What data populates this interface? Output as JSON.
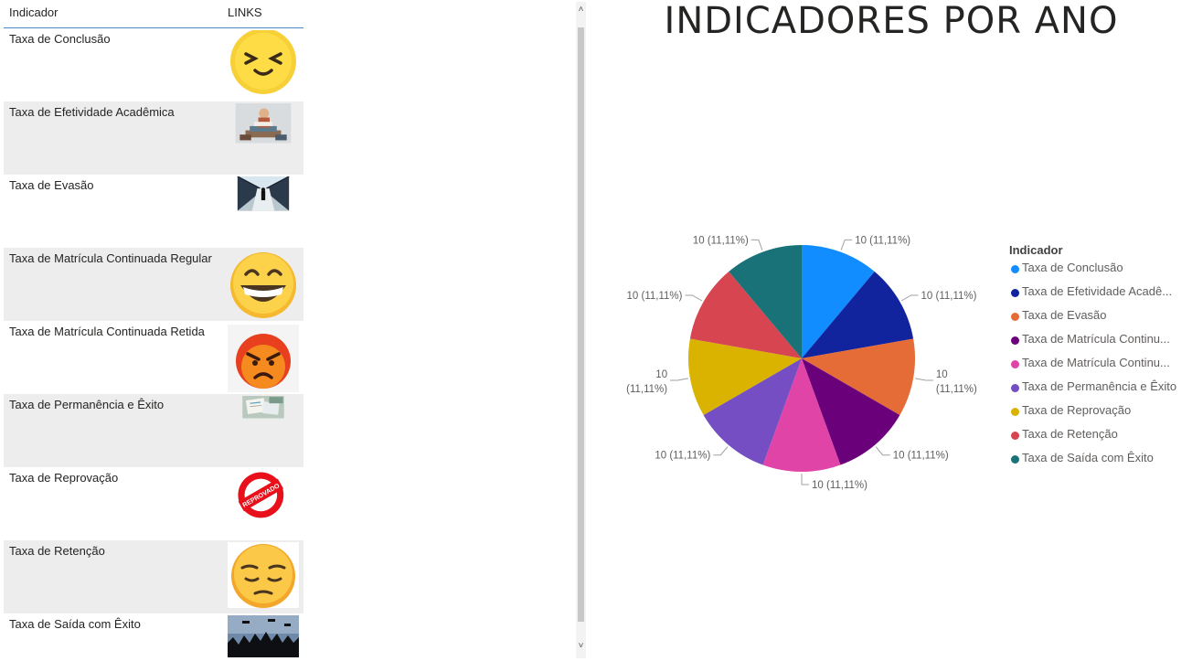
{
  "table": {
    "headers": {
      "indicador": "Indicador",
      "links": "LINKS"
    },
    "rows": [
      {
        "label": "Taxa de Conclusão",
        "thumb": "squinting-smile-emoji-icon"
      },
      {
        "label": "Taxa de Efetividade Acadêmica",
        "thumb": "student-reading-books-image"
      },
      {
        "label": "Taxa de Evasão",
        "thumb": "person-running-bridge-image"
      },
      {
        "label": "Taxa de Matrícula Continuada Regular",
        "thumb": "grinning-emoji-icon"
      },
      {
        "label": "Taxa de Matrícula Continuada Retida",
        "thumb": "angry-emoji-icon"
      },
      {
        "label": "Taxa de Permanência e Êxito",
        "thumb": "desk-papers-image"
      },
      {
        "label": "Taxa de Reprovação",
        "thumb": "reprovado-stamp-icon"
      },
      {
        "label": "Taxa de Retenção",
        "thumb": "pensive-emoji-icon"
      },
      {
        "label": "Taxa de Saída com Êxito",
        "thumb": "graduation-caps-image"
      }
    ],
    "thumb_text": {
      "stamp": "REPROVADO"
    }
  },
  "chart_data": {
    "type": "pie",
    "title": "INDICADORES POR ANO",
    "legend_title": "Indicador",
    "legend_position": "right",
    "slices": [
      {
        "name": "Taxa de Conclusão",
        "legend_label": "Taxa de Conclusão",
        "value": 10,
        "percent_label": "(11,11%)",
        "color": "#118DFF"
      },
      {
        "name": "Taxa de Efetividade Acadêmica",
        "legend_label": "Taxa de Efetividade Acadê...",
        "value": 10,
        "percent_label": "(11,11%)",
        "color": "#12239E"
      },
      {
        "name": "Taxa de Evasão",
        "legend_label": "Taxa de Evasão",
        "value": 10,
        "percent_label": "(11,11%)",
        "color": "#E66C37"
      },
      {
        "name": "Taxa de Matrícula Continuada Regular",
        "legend_label": "Taxa de Matrícula Continu...",
        "value": 10,
        "percent_label": "(11,11%)",
        "color": "#6B007B"
      },
      {
        "name": "Taxa de Matrícula Continuada Retida",
        "legend_label": "Taxa de Matrícula Continu...",
        "value": 10,
        "percent_label": "(11,11%)",
        "color": "#E044A7"
      },
      {
        "name": "Taxa de Permanência e Êxito",
        "legend_label": "Taxa de Permanência e Êxito",
        "value": 10,
        "percent_label": "(11,11%)",
        "color": "#744EC2"
      },
      {
        "name": "Taxa de Reprovação",
        "legend_label": "Taxa de Reprovação",
        "value": 10,
        "percent_label": "(11,11%)",
        "color": "#D9B300"
      },
      {
        "name": "Taxa de Retenção",
        "legend_label": "Taxa de Retenção",
        "value": 10,
        "percent_label": "(11,11%)",
        "color": "#D64550"
      },
      {
        "name": "Taxa de Saída com Êxito",
        "legend_label": "Taxa de Saída com Êxito",
        "value": 10,
        "percent_label": "(11,11%)",
        "color": "#197278"
      }
    ]
  },
  "scrollbar": {
    "up_glyph": "˄",
    "down_glyph": "˅"
  }
}
